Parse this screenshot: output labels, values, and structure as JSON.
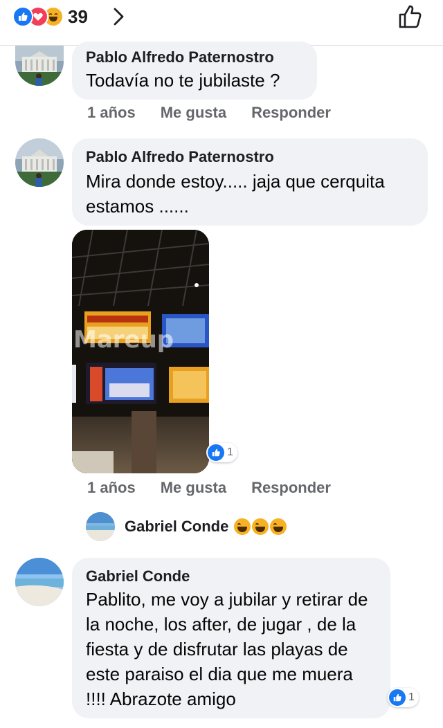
{
  "header": {
    "reaction_count": "39",
    "reactions": [
      "like-icon",
      "love-icon",
      "haha-icon"
    ]
  },
  "comments": [
    {
      "author": "Pablo Alfredo Paternostro",
      "text": "Todavía no te jubilaste ?",
      "time": "1 años",
      "like": "Me gusta",
      "reply": "Responder"
    },
    {
      "author": "Pablo Alfredo Paternostro",
      "text": "Mira donde estoy..... jaja que cerquita estamos ......",
      "time": "1 años",
      "like": "Me gusta",
      "reply": "Responder",
      "photo_watermark": "Mareup",
      "reaction_count": "1"
    },
    {
      "author": "Gabriel Conde",
      "text": "Pablito, me voy a jubilar y retirar de la noche, los after, de jugar , de la fiesta y de disfrutar las playas de este paraiso el dia que me muera !!!! Abrazote amigo",
      "reaction_count": "1"
    }
  ],
  "reply_preview": {
    "author": "Gabriel Conde",
    "emojis": [
      "haha-icon",
      "haha-icon",
      "haha-icon"
    ]
  },
  "colors": {
    "brand_blue": "#1877f2",
    "love_red": "#f33e58",
    "haha_yellow": "#f7b125",
    "bubble_bg": "#f0f2f5",
    "meta_gray": "#65676b"
  }
}
